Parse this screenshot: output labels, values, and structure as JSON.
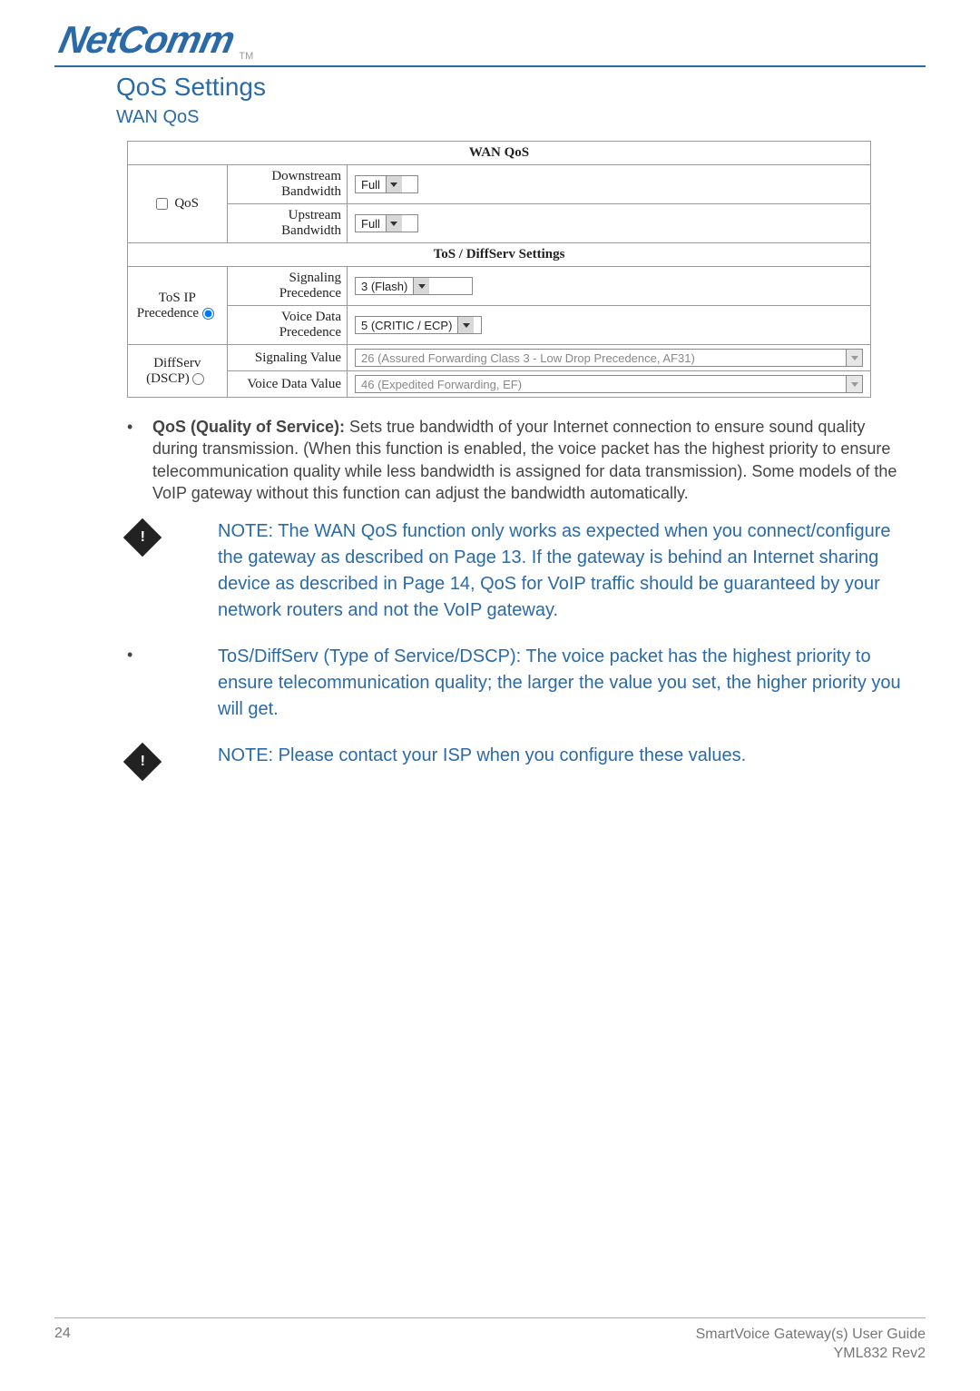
{
  "brand": {
    "name": "NetComm",
    "tm": "TM"
  },
  "headings": {
    "h1": "QoS Settings",
    "h2": "WAN QoS"
  },
  "table": {
    "section1": "WAN QoS",
    "qos_label": "QoS",
    "downstream_label": "Downstream Bandwidth",
    "downstream_value": "Full",
    "upstream_label": "Upstream Bandwidth",
    "upstream_value": "Full",
    "section2": "ToS / DiffServ Settings",
    "tos_label": "ToS IP Precedence",
    "sig_prec_label": "Signaling Precedence",
    "sig_prec_value": "3 (Flash)",
    "voice_prec_label": "Voice Data Precedence",
    "voice_prec_value": "5 (CRITIC / ECP)",
    "diffserv_label": "DiffServ (DSCP)",
    "sig_val_label": "Signaling Value",
    "sig_val_value": "26 (Assured Forwarding Class 3 - Low Drop Precedence, AF31)",
    "voice_val_label": "Voice Data Value",
    "voice_val_value": "46 (Expedited Forwarding, EF)"
  },
  "body": {
    "qos_bold": "QoS (Quality of Service):",
    "qos_text": " Sets true bandwidth of your Internet connection to ensure sound quality during transmission. (When this function is enabled, the voice packet has the highest priority to ensure telecommunication quality while less bandwidth is assigned for data transmission). Some models of the VoIP gateway without this function can adjust the bandwidth automatically.",
    "note1": "NOTE: The WAN QoS function only works as expected when you connect/configure the gateway as described on Page 13. If the gateway is behind an Internet sharing device as described in Page 14, QoS for VoIP traffic should be guaranteed by your network routers and not the VoIP gateway.",
    "tos_bullet": "ToS/DiffServ (Type of Service/DSCP): The voice packet has the highest priority to ensure telecommunication quality; the larger the value you set, the higher priority you will get.",
    "note2": "NOTE: Please contact your ISP when you configure these values."
  },
  "footer": {
    "page": "24",
    "title": "SmartVoice Gateway(s) User Guide",
    "rev": "YML832 Rev2"
  }
}
